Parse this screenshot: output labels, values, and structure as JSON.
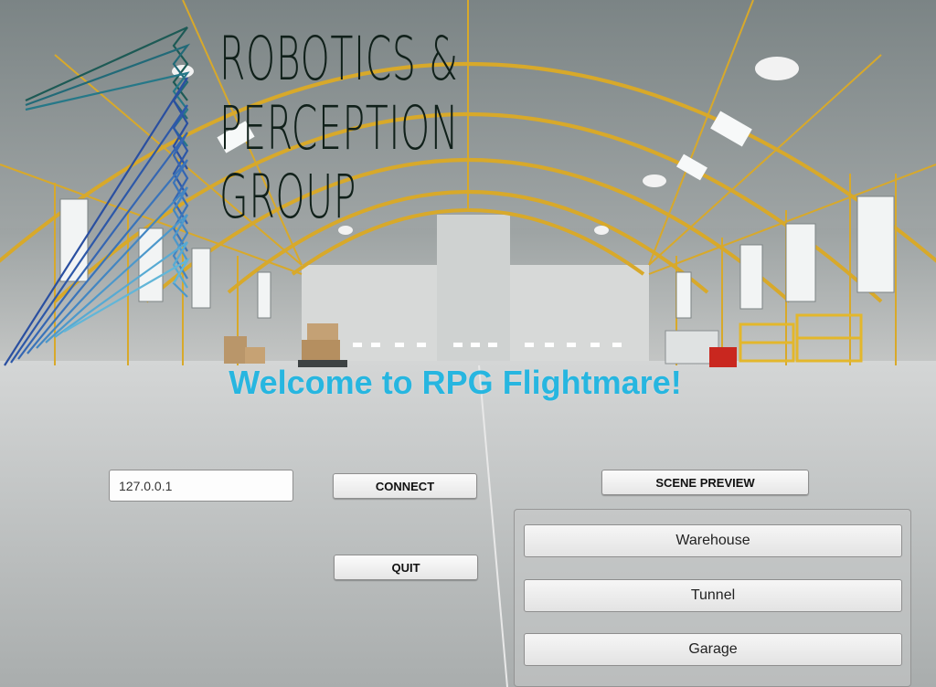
{
  "logo": {
    "line1": "ROBOTICS &",
    "line2": "PERCEPTION",
    "line3": "GROUP"
  },
  "welcome": "Welcome to RPG Flightmare!",
  "connection": {
    "ip_value": "127.0.0.1",
    "connect_label": "CONNECT",
    "quit_label": "QUIT"
  },
  "scene_preview": {
    "label": "SCENE PREVIEW",
    "scenes": [
      "Warehouse",
      "Tunnel",
      "Garage"
    ]
  },
  "colors": {
    "welcome_text": "#27b6e0",
    "logo_text": "#10201a",
    "hangar_frame": "#d8a92a"
  }
}
